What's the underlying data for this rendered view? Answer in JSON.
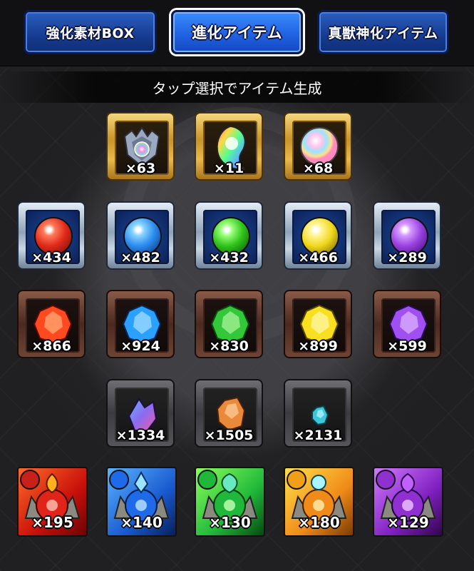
{
  "tabs": [
    {
      "label": "強化素材BOX",
      "active": false
    },
    {
      "label": "進化アイテム",
      "active": true
    },
    {
      "label": "真獣神化アイテム",
      "active": false
    }
  ],
  "caption": "タップ選択でアイテム生成",
  "rows": [
    {
      "frame": "gold",
      "items": [
        {
          "icon": "helmet-gem-icon",
          "count": "×63"
        },
        {
          "icon": "rainbow-flame-icon",
          "count": "×11"
        },
        {
          "icon": "rainbow-orb-icon",
          "count": "×68"
        }
      ]
    },
    {
      "frame": "silver",
      "items": [
        {
          "icon": "red-orb-icon",
          "color": "#e02a1a",
          "count": "×434"
        },
        {
          "icon": "blue-orb-icon",
          "color": "#2a8cf0",
          "count": "×482"
        },
        {
          "icon": "green-orb-icon",
          "color": "#2ec41a",
          "count": "×432"
        },
        {
          "icon": "yellow-orb-icon",
          "color": "#f0d81a",
          "count": "×466"
        },
        {
          "icon": "purple-orb-icon",
          "color": "#9a40e0",
          "count": "×289"
        }
      ]
    },
    {
      "frame": "bronze",
      "items": [
        {
          "icon": "red-stone-icon",
          "color": "#ff4a20",
          "count": "×866"
        },
        {
          "icon": "blue-stone-icon",
          "color": "#2aa0ff",
          "count": "×924"
        },
        {
          "icon": "green-stone-icon",
          "color": "#32c83a",
          "count": "×830"
        },
        {
          "icon": "yellow-stone-icon",
          "color": "#f8e020",
          "count": "×899"
        },
        {
          "icon": "purple-stone-icon",
          "color": "#a050f0",
          "count": "×599"
        }
      ]
    },
    {
      "frame": "dark",
      "items": [
        {
          "icon": "violet-crystal-icon",
          "color": "#8a6cf0",
          "count": "×1334"
        },
        {
          "icon": "orange-crystal-icon",
          "color": "#e88a3a",
          "count": "×1505"
        },
        {
          "icon": "cyan-crystal-icon",
          "color": "#3ac8d8",
          "count": "×2131"
        }
      ]
    },
    {
      "frame": "card",
      "items": [
        {
          "icon": "fire-dragon-egg-icon",
          "color": "#e0241a",
          "count": "×195"
        },
        {
          "icon": "water-dragon-egg-icon",
          "color": "#1f6ae8",
          "count": "×140"
        },
        {
          "icon": "wood-dragon-egg-icon",
          "color": "#20b83a",
          "count": "×130"
        },
        {
          "icon": "light-dragon-egg-icon",
          "color": "#f0a018",
          "count": "×180"
        },
        {
          "icon": "dark-dragon-egg-icon",
          "color": "#9030d0",
          "count": "×129"
        }
      ]
    }
  ]
}
